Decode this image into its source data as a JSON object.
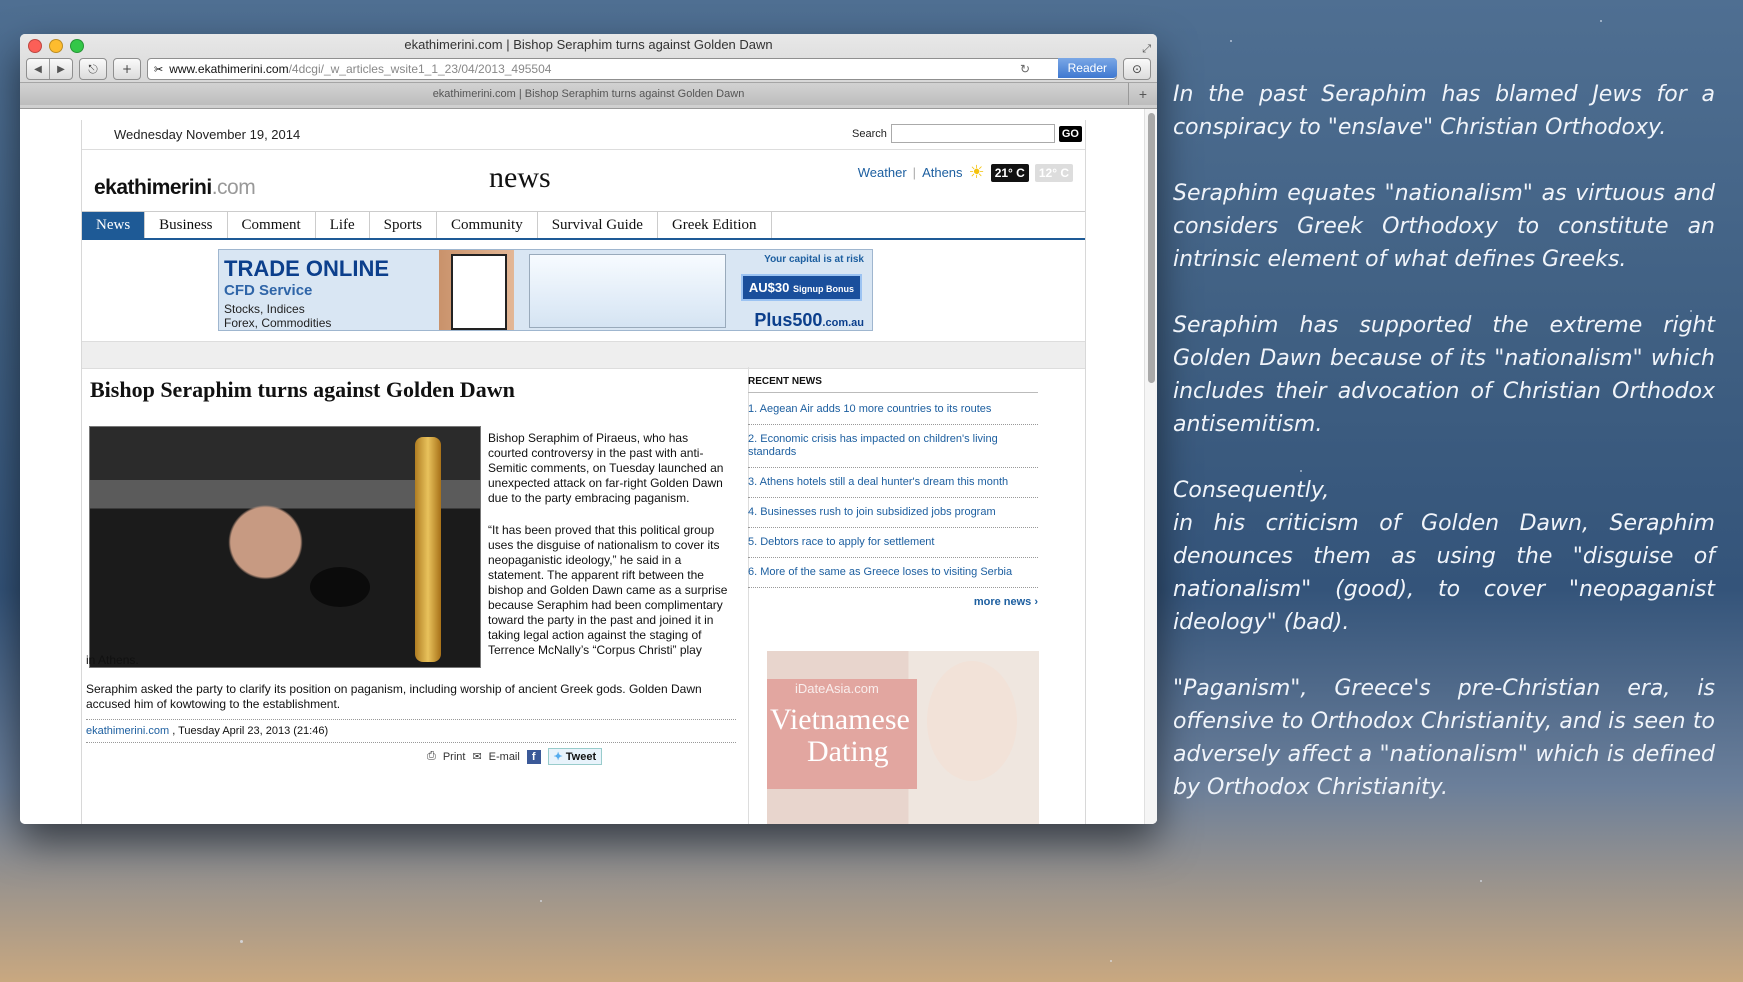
{
  "window": {
    "title": "ekathimerini.com | Bishop Seraphim turns against Golden Dawn",
    "tab_title": "ekathimerini.com | Bishop Seraphim turns against Golden Dawn",
    "url_host": "www.ekathimerini.com",
    "url_path": "/4dcgi/_w_articles_wsite1_1_23/04/2013_495504",
    "reader_label": "Reader",
    "tab_plus": "+"
  },
  "page": {
    "date": "Wednesday November 19, 2014",
    "search_label": "Search",
    "search_button": "GO",
    "logo_main": "ekathimerini",
    "logo_suffix": ".com",
    "section_title": "news",
    "weather_label": "Weather",
    "weather_separator": "|",
    "weather_city": "Athens",
    "temp_high": "21° C",
    "temp_low": "12° C",
    "nav": [
      "News",
      "Business",
      "Comment",
      "Life",
      "Sports",
      "Community",
      "Survival Guide",
      "Greek Edition"
    ]
  },
  "banner": {
    "title": "TRADE ONLINE",
    "subtitle": "CFD Service",
    "line1": "Stocks, Indices",
    "line2": "Forex, Commodities",
    "risk": "Your capital is at risk",
    "bonus_amount": "AU$30",
    "bonus_label": "Signup Bonus",
    "brand": "Plus500",
    "brand_suffix": ".com.au"
  },
  "article": {
    "headline": "Bishop Seraphim turns against Golden Dawn",
    "para1": "Bishop Seraphim of Piraeus, who has courted controversy in the past with anti-Semitic comments, on Tuesday launched an unexpected attack on far-right Golden Dawn due to the party embracing paganism.",
    "para2": "“It has been proved that this political group uses the disguise of nationalism to cover its neopaganistic ideology,” he said in a statement. The apparent rift between the bishop and Golden Dawn came as a surprise because Seraphim had been complimentary toward the party in the past and joined it in taking legal action against the staging of Terrence McNally’s “Corpus Christi” play",
    "para2_end": "in Athens.",
    "para3": "Seraphim asked the party to clarify its position on paganism, including worship of ancient Greek gods. Golden Dawn accused him of kowtowing to the establishment.",
    "byline_source": "ekathimerini.com",
    "byline_date": " , Tuesday April 23, 2013 (21:46)",
    "share_print": "Print",
    "share_email": "E-mail",
    "share_fb": "f",
    "share_tweet": "Tweet"
  },
  "sidebar": {
    "title": "RECENT NEWS",
    "items": [
      "1. Aegean Air adds 10 more countries to its routes",
      "2. Economic crisis has impacted on children's living standards",
      "3. Athens hotels still a deal hunter's dream this month",
      "4. Businesses rush to join subsidized jobs program",
      "5. Debtors race to apply for settlement",
      "6. More of the same as Greece loses to visiting Serbia"
    ],
    "more": "more news ›"
  },
  "ad2": {
    "site": "iDateAsia.com",
    "line1": "Vietnamese",
    "line2": "Dating"
  },
  "commentary": [
    "In the past Seraphim has blamed Jews for a conspiracy to \"enslave\" Christian Orthodoxy.",
    "Seraphim equates \"nationalism\" as virtuous and considers Greek Orthodoxy to constitute an intrinsic element of what defines Greeks.",
    "Seraphim has supported the extreme right Golden Dawn because of its \"nationalism\" which includes their advocation of Christian Orthodox antisemitism.",
    "Consequently,",
    "in his criticism of Golden Dawn, Seraphim denounces them as using the \"disguise of nationalism\" (good), to cover \"neopaganist ideology\" (bad).",
    "\"Paganism\", Greece's pre-Christian era, is offensive to Orthodox Christianity, and is seen to adversely affect a \"nationalism\" which is defined by Orthodox Christianity."
  ],
  "colors": {
    "accent_blue": "#1e5a96",
    "link_blue": "#1d5fa0"
  }
}
